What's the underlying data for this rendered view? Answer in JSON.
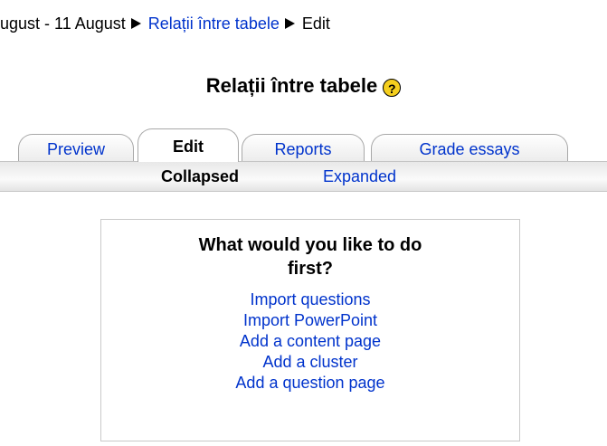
{
  "breadcrumb": {
    "partial_text": "ugust - 11 August",
    "link_label": "Relații între tabele",
    "current": "Edit"
  },
  "page": {
    "title": "Relații între tabele",
    "help_icon": "help-icon",
    "help_glyph": "?"
  },
  "tabs": [
    {
      "label": "Preview",
      "selected": false
    },
    {
      "label": "Edit",
      "selected": true
    },
    {
      "label": "Reports",
      "selected": false
    },
    {
      "label": "Grade essays",
      "selected": false
    }
  ],
  "subtabs": [
    {
      "label": "Collapsed",
      "selected": true
    },
    {
      "label": "Expanded",
      "selected": false
    }
  ],
  "first_action_box": {
    "heading_line1": "What would you like to do",
    "heading_line2": "first?",
    "links": [
      "Import questions",
      "Import PowerPoint",
      "Add a content page",
      "Add a cluster",
      "Add a question page"
    ]
  },
  "colors": {
    "link": "#0033cc",
    "help_icon": "#f5cf1e"
  }
}
